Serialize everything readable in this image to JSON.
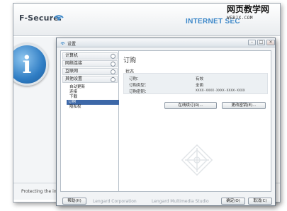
{
  "background_window": {
    "brand": "F-Secure.",
    "product_title": "INTERNET SEC",
    "status_text": "Protecting the in"
  },
  "watermark": {
    "title": "网页教学网",
    "url": "WEBJX.COM"
  },
  "dialog": {
    "title": "设置",
    "window_controls": {
      "minimize": "–",
      "maximize": "□",
      "close": "×"
    },
    "nav": {
      "categories": [
        {
          "label": "计算机"
        },
        {
          "label": "网络连接"
        },
        {
          "label": "互联网"
        },
        {
          "label": "其他设置"
        }
      ],
      "sub_items": [
        {
          "label": "自动更新"
        },
        {
          "label": "连接"
        },
        {
          "label": "下载"
        },
        {
          "label": "订购",
          "selected": true
        },
        {
          "label": "隐私权"
        }
      ]
    },
    "content": {
      "section_title": "订购",
      "status_label": "状态",
      "rows": [
        {
          "key": "订购：",
          "value": "有效"
        },
        {
          "key": "订购类型：",
          "value": "全面"
        },
        {
          "key": "订购密钥：",
          "value": "XXXX-XXXX-XXXX-XXXX-XXXX"
        }
      ],
      "renew_button": "在线续订(R)...",
      "change_key_button": "更改密钥(E)..."
    },
    "footer": {
      "help_button": "帮助(H)",
      "credits": [
        "Lengard Corporation",
        "Lengard Multimedia Studio"
      ],
      "ok_button": "确定(O)",
      "cancel_button": "取消(C)"
    }
  },
  "colors": {
    "accent": "#3a86c8",
    "selection": "#3d68a8",
    "info_icon": "#2f7dc4"
  },
  "icons": [
    "fsecure-logo-icon",
    "info-icon",
    "settings-icon",
    "chevron-up-icon",
    "brand-emblem-icon"
  ]
}
